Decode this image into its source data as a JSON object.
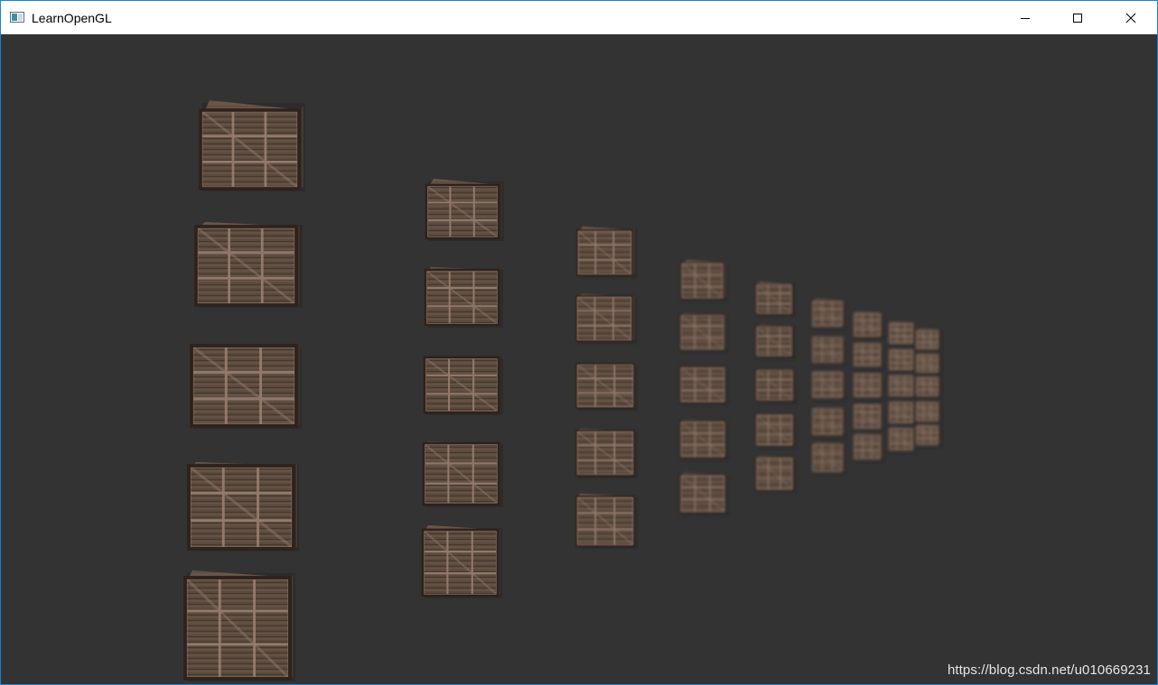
{
  "window": {
    "title": "LearnOpenGL",
    "minimize_label": "Minimize",
    "maximize_label": "Maximize",
    "close_label": "Close"
  },
  "viewport": {
    "clear_color": "#333333",
    "crate_face_color": "#5a4a3e",
    "crate_dark_color": "#2e241e",
    "crate_light_color": "#9c8272",
    "cube_grid": {
      "columns": 9,
      "rows_per_column": 5
    }
  },
  "watermark": {
    "text": "https://blog.csdn.net/u010669231"
  }
}
